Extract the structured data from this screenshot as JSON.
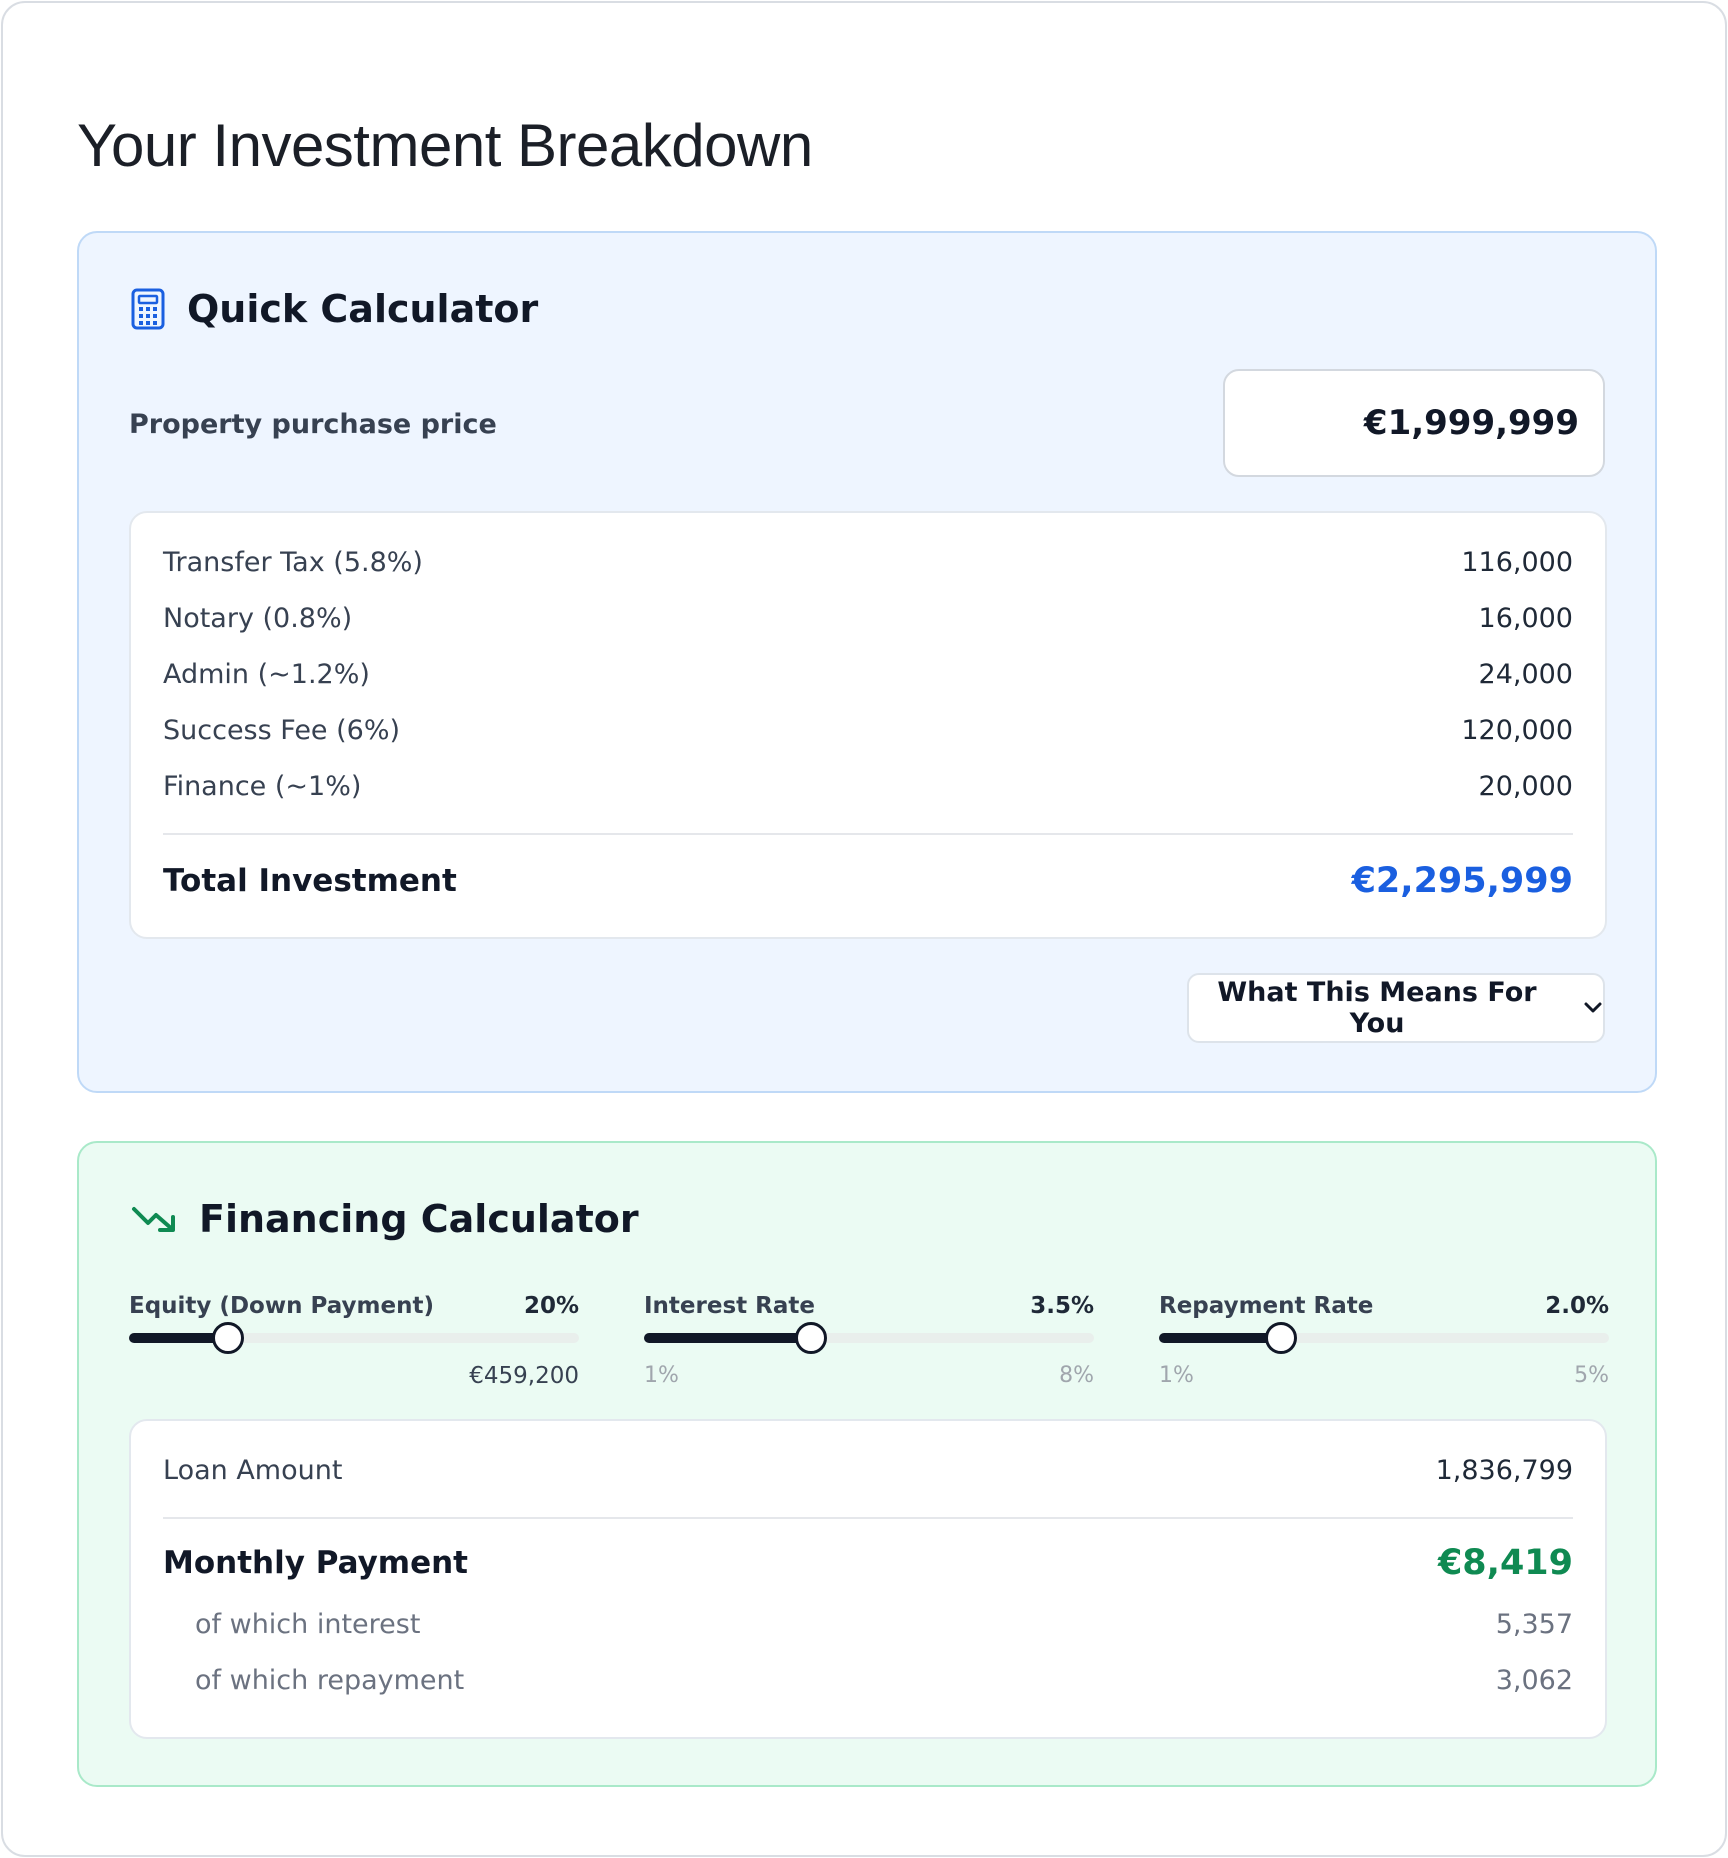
{
  "page": {
    "title": "Your Investment Breakdown"
  },
  "quick": {
    "title": "Quick Calculator",
    "icon": "calculator-icon",
    "price_label": "Property purchase price",
    "price_value": "€1,999,999",
    "costs": [
      {
        "label": "Transfer Tax (5.8%)",
        "value": "116,000"
      },
      {
        "label": "Notary (0.8%)",
        "value": "16,000"
      },
      {
        "label": "Admin (~1.2%)",
        "value": "24,000"
      },
      {
        "label": "Success Fee (6%)",
        "value": "120,000"
      },
      {
        "label": "Finance (~1%)",
        "value": "20,000"
      }
    ],
    "total_label": "Total Investment",
    "total_value": "€2,295,999",
    "total_color": "#1a5fe0",
    "toggle_label": "What This Means For You",
    "toggle_icon": "chevron-down-icon"
  },
  "finance": {
    "title": "Financing Calculator",
    "icon": "trending-down-icon",
    "sliders": [
      {
        "label": "Equity (Down Payment)",
        "value": "20%",
        "fraction": 0.22,
        "amount": "€459,200",
        "min": "",
        "max": ""
      },
      {
        "label": "Interest Rate",
        "value": "3.5%",
        "fraction": 0.37,
        "amount": "",
        "min": "1%",
        "max": "8%"
      },
      {
        "label": "Repayment Rate",
        "value": "2.0%",
        "fraction": 0.27,
        "amount": "",
        "min": "1%",
        "max": "5%"
      }
    ],
    "loan_label": "Loan Amount",
    "loan_value": "1,836,799",
    "monthly_label": "Monthly Payment",
    "monthly_value": "€8,419",
    "monthly_color": "#0f8a52",
    "interest_label": "of which interest",
    "interest_value": "5,357",
    "repayment_label": "of which repayment",
    "repayment_value": "3,062"
  }
}
